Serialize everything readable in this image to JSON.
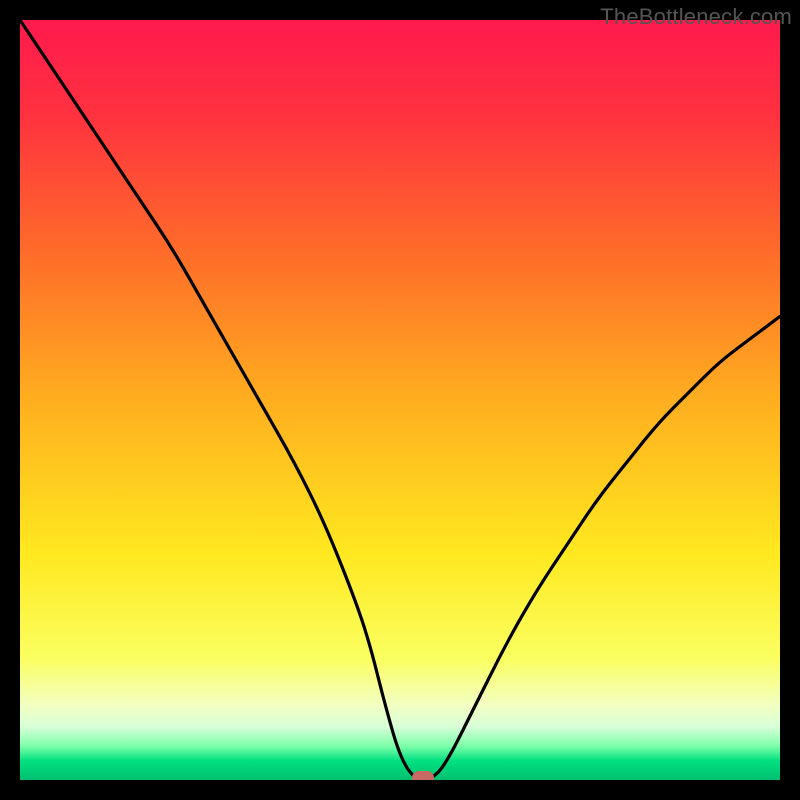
{
  "watermark": "TheBottleneck.com",
  "colors": {
    "frame": "#000000",
    "gradient_stops": [
      {
        "offset": 0.0,
        "color": "#ff1a4d"
      },
      {
        "offset": 0.12,
        "color": "#ff3040"
      },
      {
        "offset": 0.3,
        "color": "#ff6a2a"
      },
      {
        "offset": 0.5,
        "color": "#ffae1f"
      },
      {
        "offset": 0.7,
        "color": "#ffe81f"
      },
      {
        "offset": 0.84,
        "color": "#faff60"
      },
      {
        "offset": 0.9,
        "color": "#f4ffc0"
      },
      {
        "offset": 0.93,
        "color": "#d8ffd8"
      },
      {
        "offset": 0.955,
        "color": "#7fffaa"
      },
      {
        "offset": 0.975,
        "color": "#00e080"
      },
      {
        "offset": 1.0,
        "color": "#00c070"
      }
    ],
    "marker": "#c96a62",
    "curve": "#000000"
  },
  "chart_data": {
    "type": "line",
    "title": "",
    "xlabel": "",
    "ylabel": "",
    "xlim": [
      0,
      100
    ],
    "ylim": [
      0,
      100
    ],
    "x": [
      0,
      4,
      8,
      12,
      16,
      20,
      24,
      28,
      32,
      36,
      40,
      44,
      46,
      48,
      50,
      52,
      54,
      56,
      60,
      64,
      68,
      72,
      76,
      80,
      84,
      88,
      92,
      96,
      100
    ],
    "values": [
      100,
      94,
      88,
      82,
      76,
      70,
      63,
      56,
      49,
      42,
      34,
      24,
      18,
      10,
      3,
      0,
      0,
      2,
      10,
      18,
      25,
      31,
      37,
      42,
      47,
      51,
      55,
      58,
      61
    ],
    "minimum_x": 53,
    "minimum_y": 0
  }
}
